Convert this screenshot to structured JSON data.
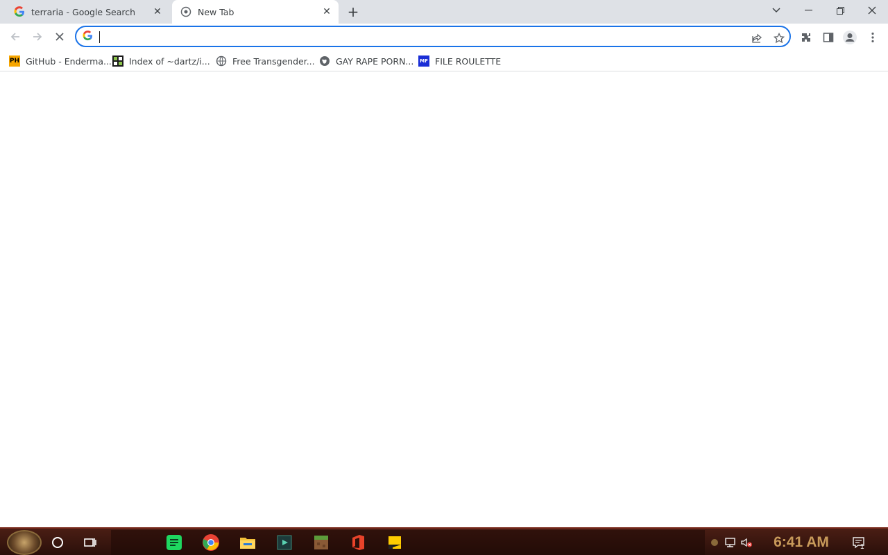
{
  "tabs": [
    {
      "title": "terraria - Google Search",
      "favicon": "google-g-icon",
      "active": false
    },
    {
      "title": "New Tab",
      "favicon": "chrome-newtab-icon",
      "active": true
    }
  ],
  "toolbar": {
    "omnibox_value": "",
    "omnibox_placeholder": ""
  },
  "bookmarks": [
    {
      "label": "GitHub - Enderma...",
      "icon": "PH"
    },
    {
      "label": "Index of ~dartz/i...",
      "icon": "index-icon"
    },
    {
      "label": "Free Transgender...",
      "icon": "globe-icon"
    },
    {
      "label": "GAY RAPE PORN...",
      "icon": "globe-icon"
    },
    {
      "label": "FILE ROULETTE",
      "icon": "MF"
    }
  ],
  "taskbar": {
    "time": "6:41 AM",
    "notification_count": "1"
  },
  "colors": {
    "accent": "#1a73e8",
    "tabstrip": "#dee1e6",
    "taskbar": "#3a160e"
  }
}
